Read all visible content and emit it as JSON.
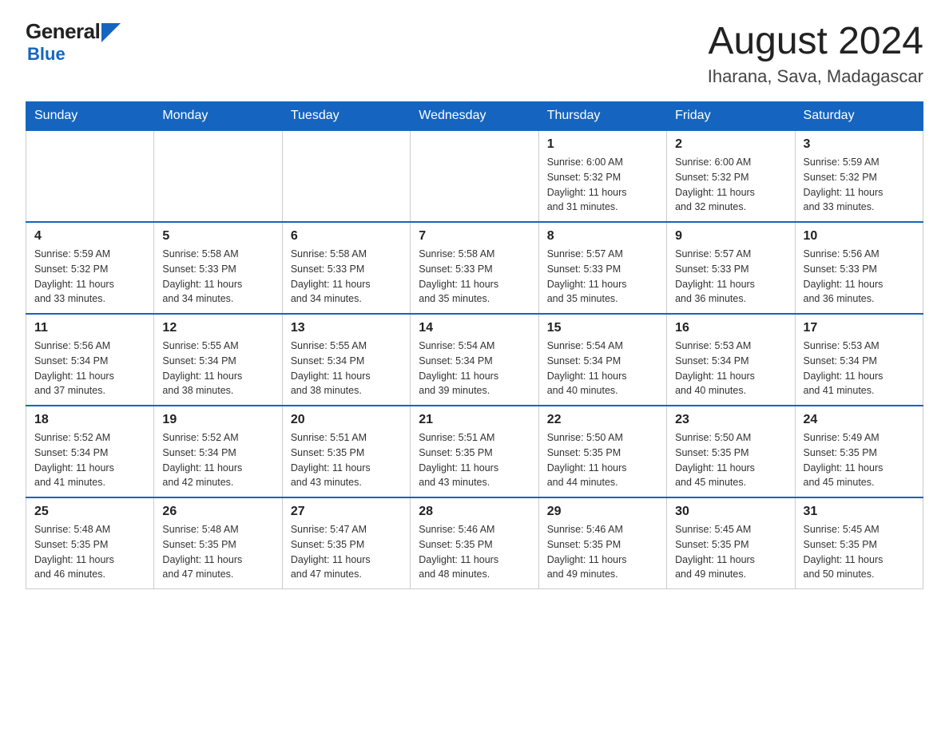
{
  "logo": {
    "general": "General",
    "blue": "Blue"
  },
  "title": "August 2024",
  "subtitle": "Iharana, Sava, Madagascar",
  "days_of_week": [
    "Sunday",
    "Monday",
    "Tuesday",
    "Wednesday",
    "Thursday",
    "Friday",
    "Saturday"
  ],
  "weeks": [
    [
      {
        "day": "",
        "info": ""
      },
      {
        "day": "",
        "info": ""
      },
      {
        "day": "",
        "info": ""
      },
      {
        "day": "",
        "info": ""
      },
      {
        "day": "1",
        "info": "Sunrise: 6:00 AM\nSunset: 5:32 PM\nDaylight: 11 hours\nand 31 minutes."
      },
      {
        "day": "2",
        "info": "Sunrise: 6:00 AM\nSunset: 5:32 PM\nDaylight: 11 hours\nand 32 minutes."
      },
      {
        "day": "3",
        "info": "Sunrise: 5:59 AM\nSunset: 5:32 PM\nDaylight: 11 hours\nand 33 minutes."
      }
    ],
    [
      {
        "day": "4",
        "info": "Sunrise: 5:59 AM\nSunset: 5:32 PM\nDaylight: 11 hours\nand 33 minutes."
      },
      {
        "day": "5",
        "info": "Sunrise: 5:58 AM\nSunset: 5:33 PM\nDaylight: 11 hours\nand 34 minutes."
      },
      {
        "day": "6",
        "info": "Sunrise: 5:58 AM\nSunset: 5:33 PM\nDaylight: 11 hours\nand 34 minutes."
      },
      {
        "day": "7",
        "info": "Sunrise: 5:58 AM\nSunset: 5:33 PM\nDaylight: 11 hours\nand 35 minutes."
      },
      {
        "day": "8",
        "info": "Sunrise: 5:57 AM\nSunset: 5:33 PM\nDaylight: 11 hours\nand 35 minutes."
      },
      {
        "day": "9",
        "info": "Sunrise: 5:57 AM\nSunset: 5:33 PM\nDaylight: 11 hours\nand 36 minutes."
      },
      {
        "day": "10",
        "info": "Sunrise: 5:56 AM\nSunset: 5:33 PM\nDaylight: 11 hours\nand 36 minutes."
      }
    ],
    [
      {
        "day": "11",
        "info": "Sunrise: 5:56 AM\nSunset: 5:34 PM\nDaylight: 11 hours\nand 37 minutes."
      },
      {
        "day": "12",
        "info": "Sunrise: 5:55 AM\nSunset: 5:34 PM\nDaylight: 11 hours\nand 38 minutes."
      },
      {
        "day": "13",
        "info": "Sunrise: 5:55 AM\nSunset: 5:34 PM\nDaylight: 11 hours\nand 38 minutes."
      },
      {
        "day": "14",
        "info": "Sunrise: 5:54 AM\nSunset: 5:34 PM\nDaylight: 11 hours\nand 39 minutes."
      },
      {
        "day": "15",
        "info": "Sunrise: 5:54 AM\nSunset: 5:34 PM\nDaylight: 11 hours\nand 40 minutes."
      },
      {
        "day": "16",
        "info": "Sunrise: 5:53 AM\nSunset: 5:34 PM\nDaylight: 11 hours\nand 40 minutes."
      },
      {
        "day": "17",
        "info": "Sunrise: 5:53 AM\nSunset: 5:34 PM\nDaylight: 11 hours\nand 41 minutes."
      }
    ],
    [
      {
        "day": "18",
        "info": "Sunrise: 5:52 AM\nSunset: 5:34 PM\nDaylight: 11 hours\nand 41 minutes."
      },
      {
        "day": "19",
        "info": "Sunrise: 5:52 AM\nSunset: 5:34 PM\nDaylight: 11 hours\nand 42 minutes."
      },
      {
        "day": "20",
        "info": "Sunrise: 5:51 AM\nSunset: 5:35 PM\nDaylight: 11 hours\nand 43 minutes."
      },
      {
        "day": "21",
        "info": "Sunrise: 5:51 AM\nSunset: 5:35 PM\nDaylight: 11 hours\nand 43 minutes."
      },
      {
        "day": "22",
        "info": "Sunrise: 5:50 AM\nSunset: 5:35 PM\nDaylight: 11 hours\nand 44 minutes."
      },
      {
        "day": "23",
        "info": "Sunrise: 5:50 AM\nSunset: 5:35 PM\nDaylight: 11 hours\nand 45 minutes."
      },
      {
        "day": "24",
        "info": "Sunrise: 5:49 AM\nSunset: 5:35 PM\nDaylight: 11 hours\nand 45 minutes."
      }
    ],
    [
      {
        "day": "25",
        "info": "Sunrise: 5:48 AM\nSunset: 5:35 PM\nDaylight: 11 hours\nand 46 minutes."
      },
      {
        "day": "26",
        "info": "Sunrise: 5:48 AM\nSunset: 5:35 PM\nDaylight: 11 hours\nand 47 minutes."
      },
      {
        "day": "27",
        "info": "Sunrise: 5:47 AM\nSunset: 5:35 PM\nDaylight: 11 hours\nand 47 minutes."
      },
      {
        "day": "28",
        "info": "Sunrise: 5:46 AM\nSunset: 5:35 PM\nDaylight: 11 hours\nand 48 minutes."
      },
      {
        "day": "29",
        "info": "Sunrise: 5:46 AM\nSunset: 5:35 PM\nDaylight: 11 hours\nand 49 minutes."
      },
      {
        "day": "30",
        "info": "Sunrise: 5:45 AM\nSunset: 5:35 PM\nDaylight: 11 hours\nand 49 minutes."
      },
      {
        "day": "31",
        "info": "Sunrise: 5:45 AM\nSunset: 5:35 PM\nDaylight: 11 hours\nand 50 minutes."
      }
    ]
  ]
}
